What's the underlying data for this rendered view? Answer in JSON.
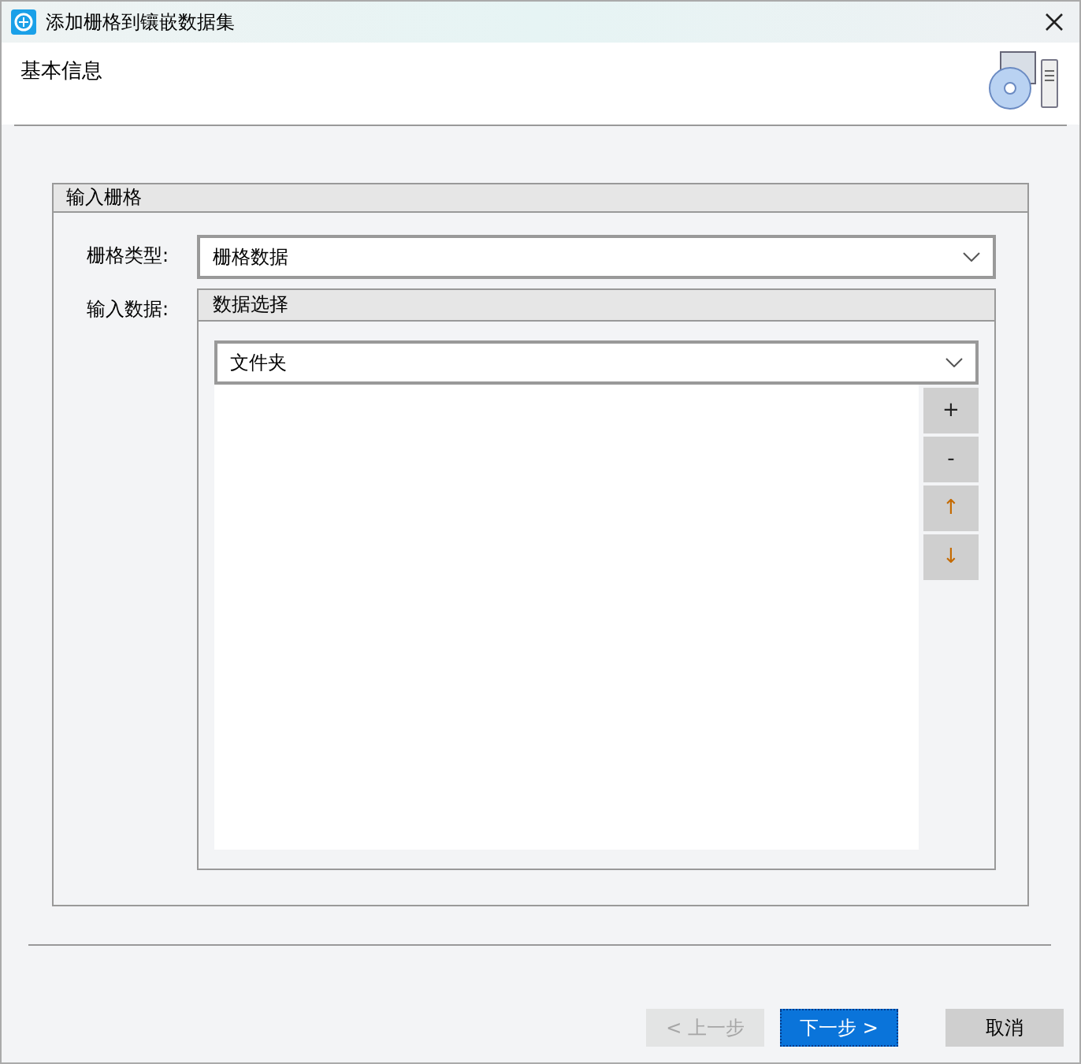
{
  "window": {
    "title": "添加栅格到镶嵌数据集"
  },
  "header": {
    "title": "基本信息"
  },
  "group": {
    "title": "输入栅格",
    "raster_type": {
      "label": "栅格类型:",
      "value": "栅格数据"
    },
    "input_data": {
      "label": "输入数据:",
      "title": "数据选择",
      "source": {
        "value": "文件夹"
      },
      "side_buttons": [
        "+",
        "-",
        "↑",
        "↓"
      ]
    }
  },
  "buttons": [
    {
      "label": "< 上一步",
      "disabled": true,
      "primary": false
    },
    {
      "label": "下一步 >",
      "disabled": false,
      "primary": true
    },
    {
      "label": "取消",
      "disabled": false,
      "primary": false
    }
  ]
}
